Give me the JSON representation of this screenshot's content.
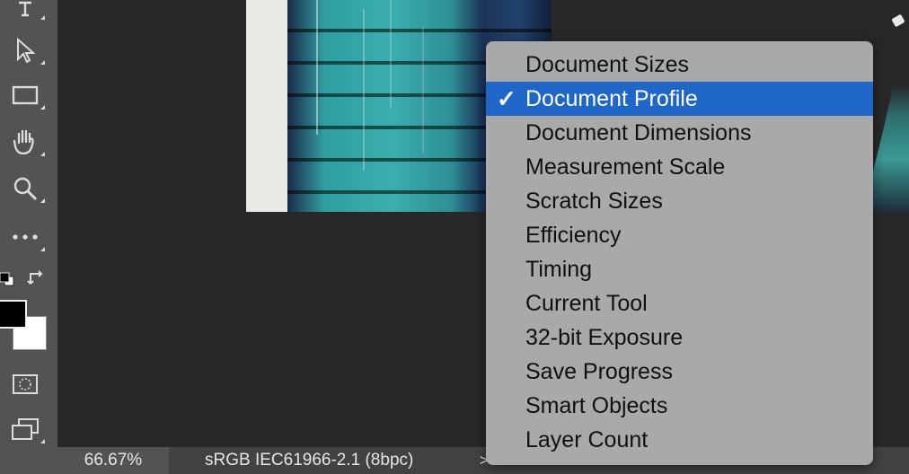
{
  "toolbar": {
    "tools": [
      {
        "icon": "type-tool-icon"
      },
      {
        "icon": "path-selection-icon"
      },
      {
        "icon": "rectangle-tool-icon"
      },
      {
        "icon": "hand-tool-icon"
      },
      {
        "icon": "zoom-tool-icon"
      },
      {
        "icon": "more-tools-icon"
      },
      {
        "icon": "quick-mask-icon"
      },
      {
        "icon": "screen-mode-icon"
      }
    ],
    "foreground_color": "#000000",
    "background_color": "#ffffff"
  },
  "status_bar": {
    "zoom": "66.67%",
    "info": "sRGB IEC61966-2.1 (8bpc)",
    "arrow": ">"
  },
  "popup_menu": {
    "check_mark": "✓",
    "items": [
      {
        "label": "Document Sizes",
        "selected": false
      },
      {
        "label": "Document Profile",
        "selected": true
      },
      {
        "label": "Document Dimensions",
        "selected": false
      },
      {
        "label": "Measurement Scale",
        "selected": false
      },
      {
        "label": "Scratch Sizes",
        "selected": false
      },
      {
        "label": "Efficiency",
        "selected": false
      },
      {
        "label": "Timing",
        "selected": false
      },
      {
        "label": "Current Tool",
        "selected": false
      },
      {
        "label": "32-bit Exposure",
        "selected": false
      },
      {
        "label": "Save Progress",
        "selected": false
      },
      {
        "label": "Smart Objects",
        "selected": false
      },
      {
        "label": "Layer Count",
        "selected": false
      }
    ],
    "highlight_color": "#1f66c9"
  }
}
